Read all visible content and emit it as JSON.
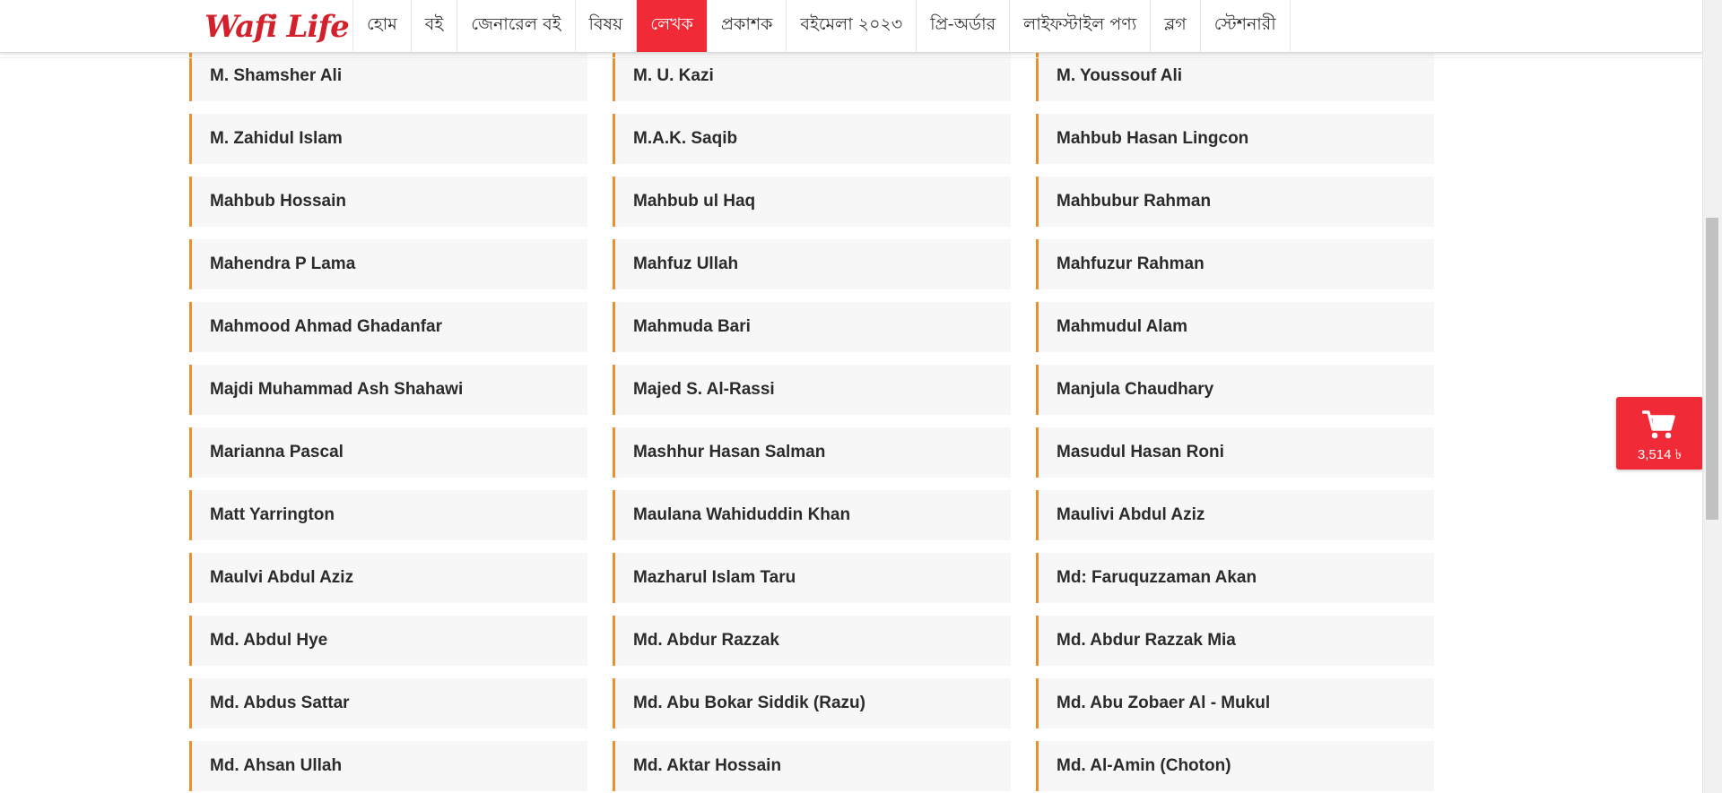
{
  "header": {
    "logo_text": "Wafi Life",
    "nav": [
      {
        "label": "হোম",
        "active": false
      },
      {
        "label": "বই",
        "active": false
      },
      {
        "label": "জেনারেল বই",
        "active": false
      },
      {
        "label": "বিষয়",
        "active": false
      },
      {
        "label": "লেখক",
        "active": true
      },
      {
        "label": "প্রকাশক",
        "active": false
      },
      {
        "label": "বইমেলা ২০২৩",
        "active": false
      },
      {
        "label": "প্রি-অর্ডার",
        "active": false
      },
      {
        "label": "লাইফস্টাইল পণ্য",
        "active": false
      },
      {
        "label": "ব্লগ",
        "active": false
      },
      {
        "label": "স্টেশনারী",
        "active": false
      }
    ]
  },
  "authors": [
    "M. Shamsher Ali",
    "M. U. Kazi",
    "M. Youssouf Ali",
    "M. Zahidul Islam",
    "M.A.K. Saqib",
    "Mahbub Hasan Lingcon",
    "Mahbub Hossain",
    "Mahbub ul Haq",
    "Mahbubur Rahman",
    "Mahendra P Lama",
    "Mahfuz Ullah",
    "Mahfuzur Rahman",
    "Mahmood Ahmad Ghadanfar",
    "Mahmuda Bari",
    "Mahmudul Alam",
    "Majdi Muhammad Ash Shahawi",
    "Majed S. Al-Rassi",
    "Manjula Chaudhary",
    "Marianna Pascal",
    "Mashhur Hasan Salman",
    "Masudul Hasan Roni",
    "Matt Yarrington",
    "Maulana Wahiduddin Khan",
    "Maulivi Abdul Aziz",
    "Maulvi Abdul Aziz",
    "Mazharul Islam Taru",
    "Md: Faruquzzaman Akan",
    "Md. Abdul Hye",
    "Md. Abdur Razzak",
    "Md. Abdur Razzak Mia",
    "Md. Abdus Sattar",
    "Md. Abu Bokar Siddik (Razu)",
    "Md. Abu Zobaer Al - Mukul",
    "Md. Ahsan Ullah",
    "Md. Aktar Hossain",
    "Md. Al-Amin (Choton)"
  ],
  "cart": {
    "icon": "shopping-cart-icon",
    "total": "3,514 ৳"
  },
  "colors": {
    "brand_red": "#f02a36",
    "logo_red": "#d3202a",
    "card_accent": "#ef8f2c",
    "card_bg": "#f7f7f7"
  }
}
